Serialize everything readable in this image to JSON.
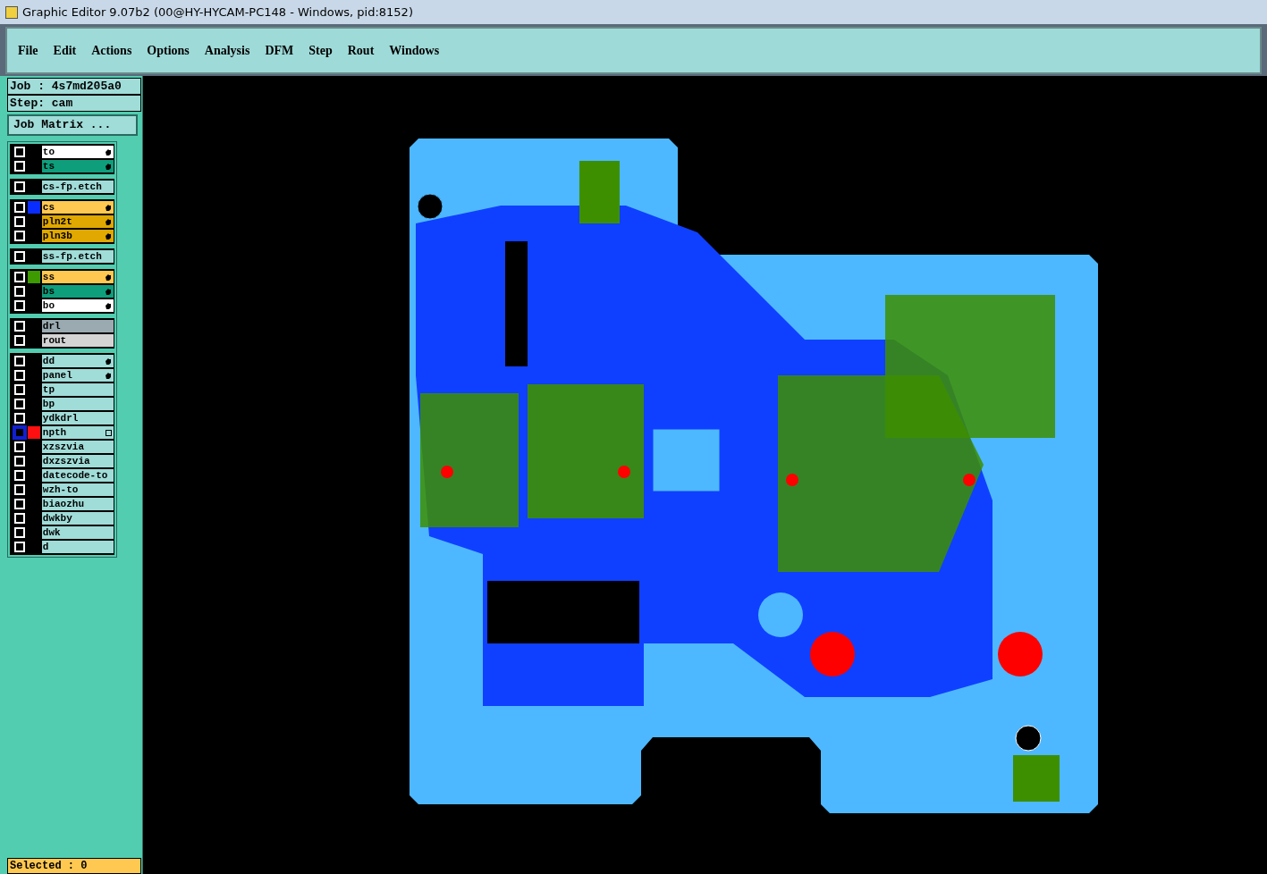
{
  "window": {
    "title": "Graphic Editor 9.07b2 (00@HY-HYCAM-PC148 - Windows, pid:8152)"
  },
  "menu": [
    "File",
    "Edit",
    "Actions",
    "Options",
    "Analysis",
    "DFM",
    "Step",
    "Rout",
    "Windows"
  ],
  "job": "Job : 4s7md205a0",
  "step": "Step: cam",
  "job_matrix_button": "Job Matrix ...",
  "layer_groups": [
    {
      "layers": [
        {
          "name": "to",
          "kind": "silk",
          "checked": false,
          "editable": true,
          "active": false
        },
        {
          "name": "ts",
          "kind": "mask",
          "checked": false,
          "editable": true,
          "active": false
        }
      ]
    },
    {
      "layers": [
        {
          "name": "cs-fp.etch",
          "kind": "document",
          "checked": false,
          "editable": false,
          "active": false
        }
      ]
    },
    {
      "layers": [
        {
          "name": "cs",
          "kind": "signal",
          "color": "#0a2dff",
          "checked": false,
          "editable": true,
          "active": false
        },
        {
          "name": "pln2t",
          "kind": "plane",
          "checked": false,
          "editable": true,
          "active": false
        },
        {
          "name": "pln3b",
          "kind": "plane",
          "checked": false,
          "editable": true,
          "active": false
        }
      ]
    },
    {
      "layers": [
        {
          "name": "ss-fp.etch",
          "kind": "document",
          "checked": false,
          "editable": false,
          "active": false
        }
      ]
    },
    {
      "layers": [
        {
          "name": "ss",
          "kind": "signal",
          "color": "#3d9a00",
          "checked": false,
          "editable": true,
          "active": false
        },
        {
          "name": "bs",
          "kind": "mask",
          "checked": false,
          "editable": true,
          "active": false
        },
        {
          "name": "bo",
          "kind": "silk",
          "checked": false,
          "editable": true,
          "active": false
        }
      ]
    },
    {
      "layers": [
        {
          "name": "drl",
          "kind": "drill",
          "checked": false,
          "editable": false,
          "active": false
        },
        {
          "name": "rout",
          "kind": "rout",
          "checked": false,
          "editable": false,
          "active": false
        }
      ]
    },
    {
      "layers": [
        {
          "name": "dd",
          "kind": "document",
          "checked": false,
          "editable": true,
          "active": false
        },
        {
          "name": "panel",
          "kind": "document",
          "checked": false,
          "editable": true,
          "active": false
        },
        {
          "name": "tp",
          "kind": "document",
          "checked": false,
          "editable": false,
          "active": false
        },
        {
          "name": "bp",
          "kind": "document",
          "checked": false,
          "editable": false,
          "active": false
        },
        {
          "name": "ydkdrl",
          "kind": "document",
          "checked": false,
          "editable": false,
          "active": false
        },
        {
          "name": "npth",
          "kind": "document",
          "color": "#ff1010",
          "checked": false,
          "editable": false,
          "active": true
        },
        {
          "name": "xzszvia",
          "kind": "document",
          "checked": false,
          "editable": false,
          "active": false
        },
        {
          "name": "dxzszvia",
          "kind": "document",
          "checked": false,
          "editable": false,
          "active": false
        },
        {
          "name": "datecode-to",
          "kind": "document",
          "checked": false,
          "editable": false,
          "active": false
        },
        {
          "name": "wzh-to",
          "kind": "document",
          "checked": false,
          "editable": false,
          "active": false
        },
        {
          "name": "biaozhu",
          "kind": "document",
          "checked": false,
          "editable": false,
          "active": false
        },
        {
          "name": "dwkby",
          "kind": "document",
          "checked": false,
          "editable": false,
          "active": false
        },
        {
          "name": "dwk",
          "kind": "document",
          "checked": false,
          "editable": false,
          "active": false
        },
        {
          "name": "d",
          "kind": "document",
          "checked": false,
          "editable": false,
          "active": false
        }
      ]
    }
  ],
  "status": "Selected : 0"
}
